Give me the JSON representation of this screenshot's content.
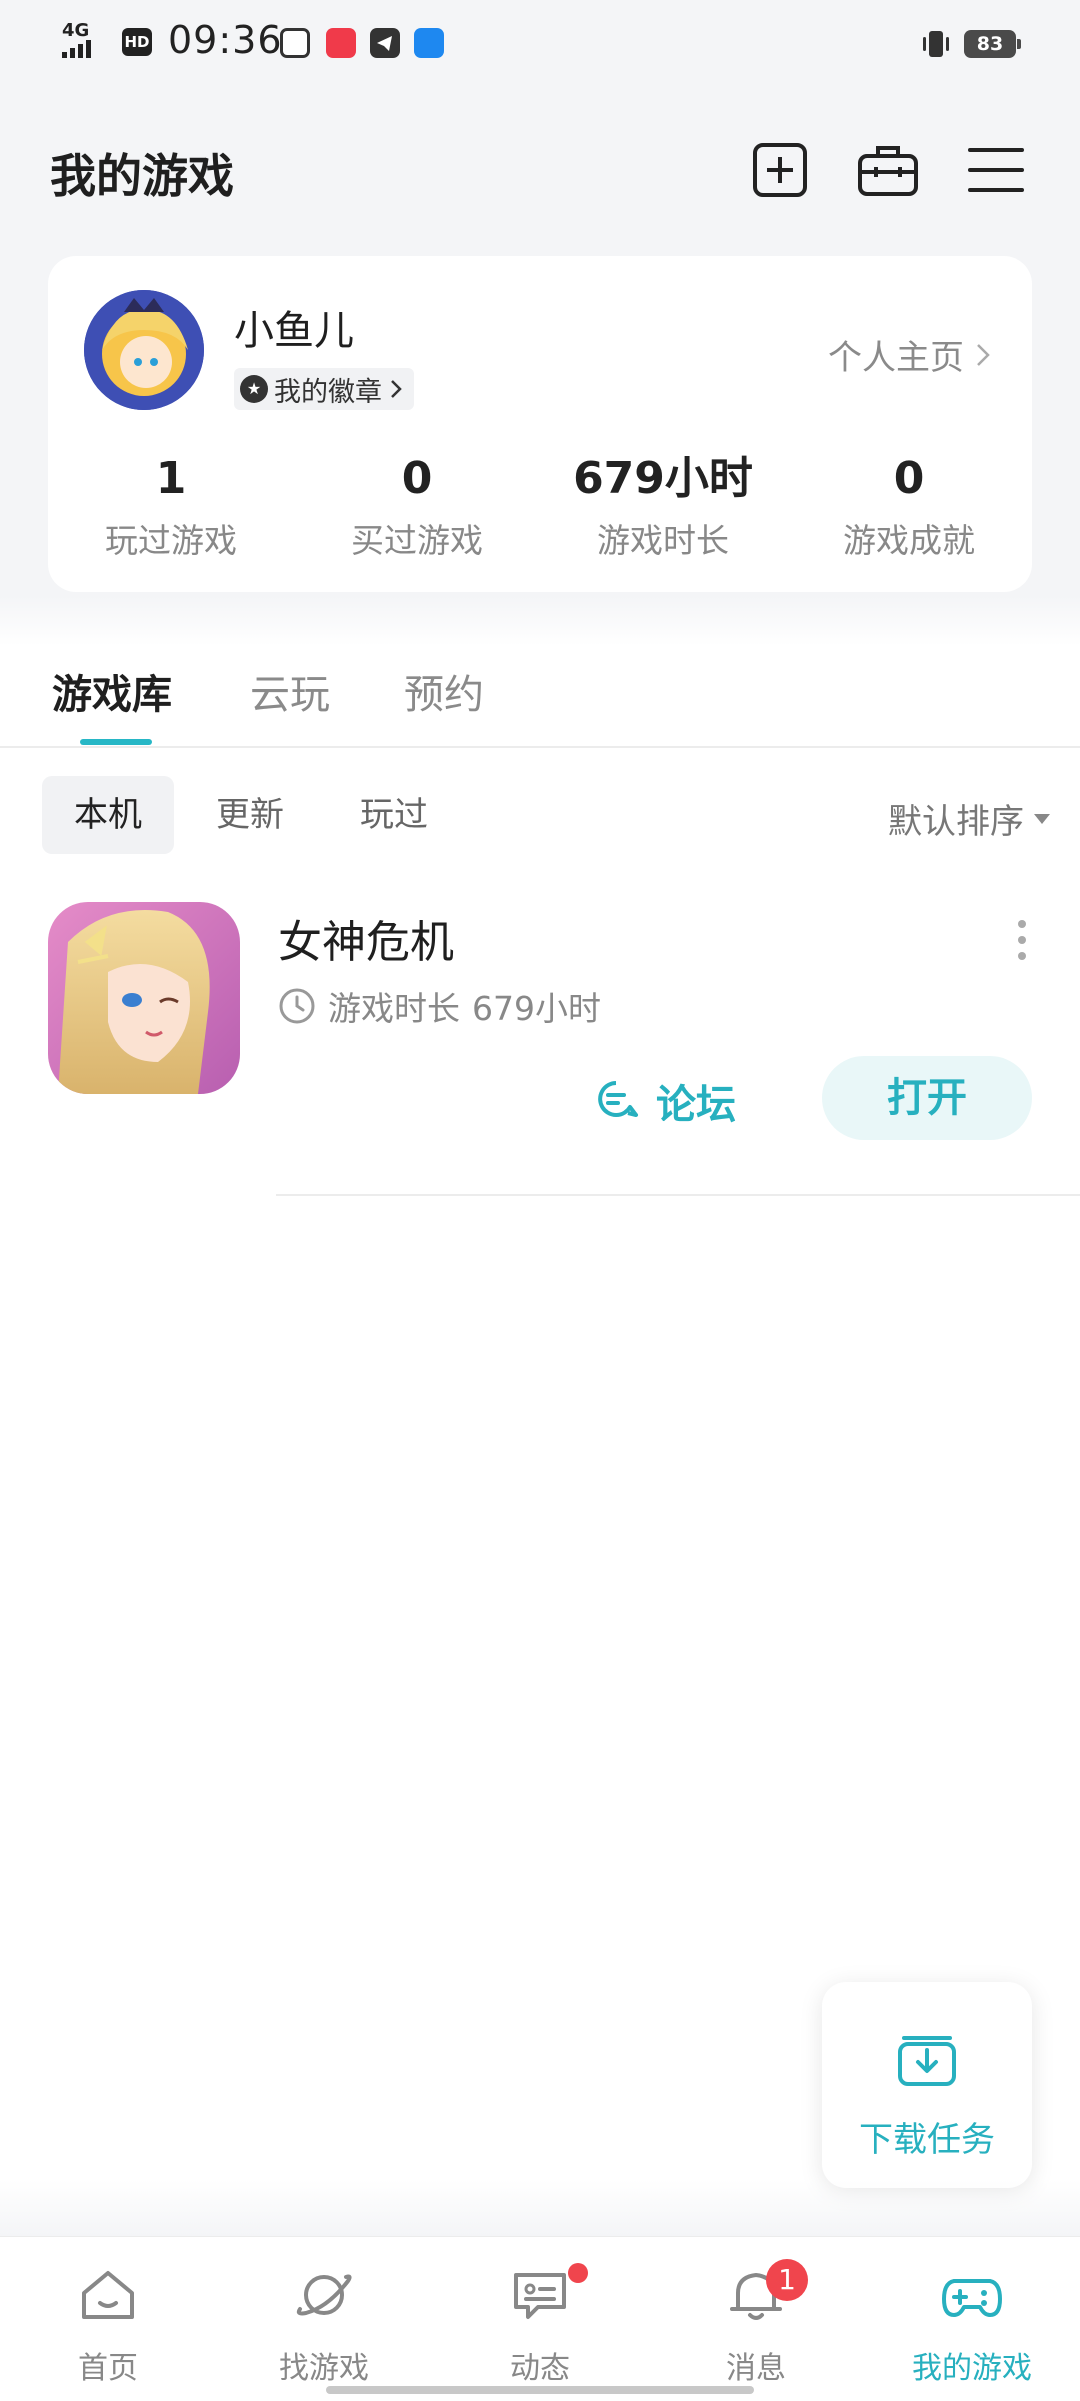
{
  "status_bar": {
    "network": "4G",
    "hd": "HD",
    "time": "09:36",
    "apps": [
      "gallery-icon",
      "xiaohongshu-icon",
      "telegram-icon",
      "alipay-icon"
    ],
    "battery": "83"
  },
  "header": {
    "title": "我的游戏",
    "icons": [
      "add-square-icon",
      "toolbox-icon",
      "menu-icon"
    ]
  },
  "profile": {
    "username": "小鱼儿",
    "badge_label": "我的徽章",
    "homepage_link": "个人主页",
    "stats": [
      {
        "value": "1",
        "label": "玩过游戏"
      },
      {
        "value": "0",
        "label": "买过游戏"
      },
      {
        "value": "679小时",
        "label": "游戏时长"
      },
      {
        "value": "0",
        "label": "游戏成就"
      }
    ]
  },
  "main_tabs": {
    "items": [
      "游戏库",
      "云玩",
      "预约"
    ],
    "active_index": 0
  },
  "sub_tabs": {
    "items": [
      "本机",
      "更新",
      "玩过"
    ],
    "active_index": 0,
    "sort_label": "默认排序"
  },
  "games": [
    {
      "name": "女神危机",
      "playtime_label": "游戏时长",
      "playtime_value": "679小时",
      "forum_label": "论坛",
      "open_label": "打开"
    }
  ],
  "download_task": {
    "label": "下载任务"
  },
  "bottom_nav": {
    "items": [
      {
        "label": "首页",
        "icon": "home-icon"
      },
      {
        "label": "找游戏",
        "icon": "planet-icon"
      },
      {
        "label": "动态",
        "icon": "feed-icon"
      },
      {
        "label": "消息",
        "icon": "bell-icon",
        "badge": "1"
      },
      {
        "label": "我的游戏",
        "icon": "gamepad-icon"
      }
    ],
    "active_index": 4
  },
  "colors": {
    "accent": "#27b0bf",
    "background": "#f4f5f7",
    "notification": "#f0454d"
  }
}
